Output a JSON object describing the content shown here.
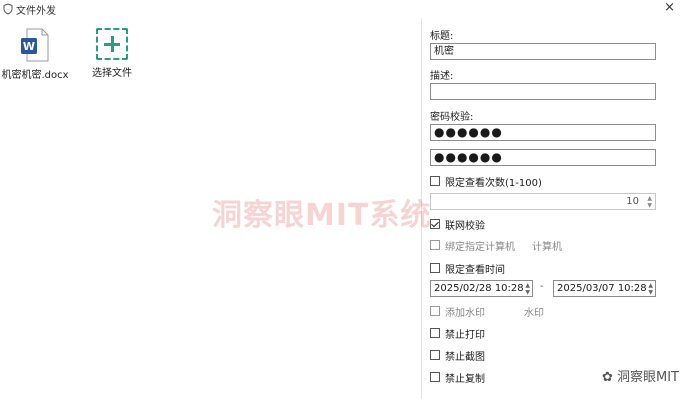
{
  "window": {
    "title": "文件外发",
    "close_glyph": "×"
  },
  "files": [
    {
      "name": "机密机密.docx",
      "icon": "word-document-icon"
    },
    {
      "name": "选择文件",
      "icon": "add-file-icon"
    }
  ],
  "form": {
    "title_label": "标题:",
    "title_value": "机密",
    "desc_label": "描述:",
    "desc_value": "",
    "password_label": "密码校验:",
    "password_value": "●●●●●●",
    "password_confirm_value": "●●●●●●",
    "limit_views_label": "限定查看次数(1-100)",
    "limit_views_checked": false,
    "limit_views_value": "10",
    "network_check_label": "联网校验",
    "network_check_checked": true,
    "bind_computer_label": "绑定指定计算机",
    "bind_computer_checked": false,
    "bind_computer_side": "计算机",
    "limit_time_label": "限定查看时间",
    "limit_time_checked": false,
    "date_start": "2025/02/28 10:28",
    "date_separator": "-",
    "date_end": "2025/03/07 10:28",
    "add_watermark_label": "添加水印",
    "add_watermark_checked": false,
    "watermark_side": "水印",
    "no_print_label": "禁止打印",
    "no_print_checked": false,
    "no_screenshot_label": "禁止截图",
    "no_screenshot_checked": false,
    "no_copy_label": "禁止复制",
    "no_copy_checked": false
  },
  "overlay": {
    "center_watermark": "洞察眼MIT系统",
    "source_mark": "洞察眼MIT"
  },
  "colors": {
    "accent": "#2a9d7e",
    "word_blue": "#2b579a"
  }
}
